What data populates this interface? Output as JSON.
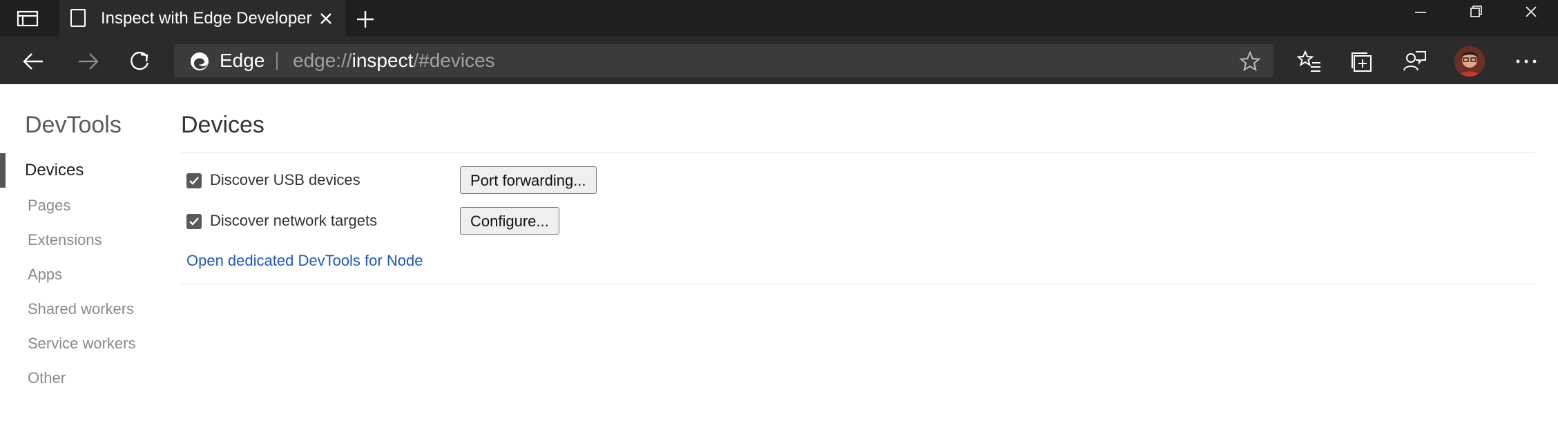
{
  "browser": {
    "tab_title": "Inspect with Edge Developer Tools",
    "address_brand": "Edge",
    "url_scheme": "edge://",
    "url_host": "inspect",
    "url_path": "/#devices"
  },
  "icons": {
    "tab_actions": "tab-actions-icon",
    "favicon": "page-icon",
    "close": "close-icon",
    "new_tab": "plus-icon",
    "back": "back-arrow-icon",
    "forward": "forward-arrow-icon",
    "refresh": "refresh-icon",
    "favorite": "star-icon",
    "favorites": "favorites-icon",
    "collections": "collections-icon",
    "feedback": "feedback-icon",
    "more": "more-icon"
  },
  "sidebar": {
    "title": "DevTools",
    "items": [
      {
        "label": "Devices",
        "active": true
      },
      {
        "label": "Pages",
        "active": false
      },
      {
        "label": "Extensions",
        "active": false
      },
      {
        "label": "Apps",
        "active": false
      },
      {
        "label": "Shared workers",
        "active": false
      },
      {
        "label": "Service workers",
        "active": false
      },
      {
        "label": "Other",
        "active": false
      }
    ]
  },
  "main": {
    "title": "Devices",
    "usb": {
      "label": "Discover USB devices",
      "checked": true,
      "button": "Port forwarding..."
    },
    "network": {
      "label": "Discover network targets",
      "checked": true,
      "button": "Configure..."
    },
    "node_link": "Open dedicated DevTools for Node"
  },
  "colors": {
    "titlebar": "#1f1f1f",
    "toolbar": "#2b2b2b",
    "link": "#1f57c3"
  }
}
